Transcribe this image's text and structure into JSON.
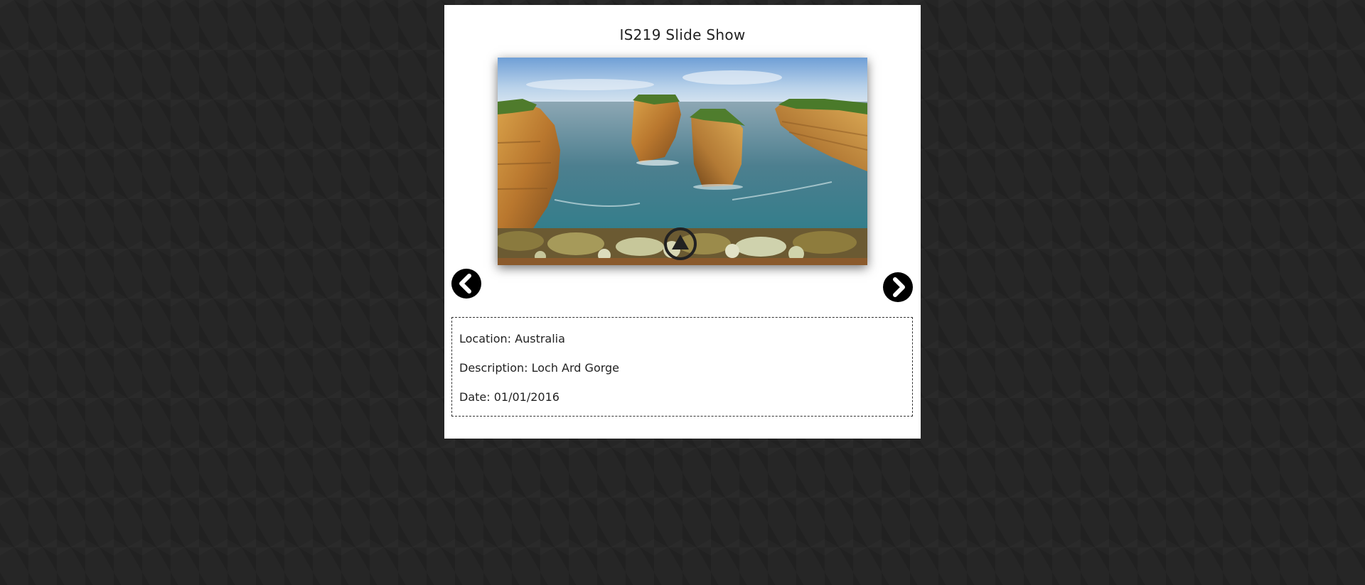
{
  "slideshow": {
    "title": "IS219 Slide Show",
    "photo": {
      "subject": "coastal-sea-stacks-photo"
    },
    "controls": {
      "play_icon": "play-triangle-icon",
      "prev_icon": "chevron-left-icon",
      "next_icon": "chevron-right-icon"
    },
    "info": {
      "location_label": "Location:",
      "location_value": "Australia",
      "description_label": "Description:",
      "description_value": "Loch Ard Gorge",
      "date_label": "Date:",
      "date_value": "01/01/2016"
    }
  },
  "colors": {
    "page_background": "#262626",
    "card_background": "#ffffff",
    "button": "#000000"
  }
}
